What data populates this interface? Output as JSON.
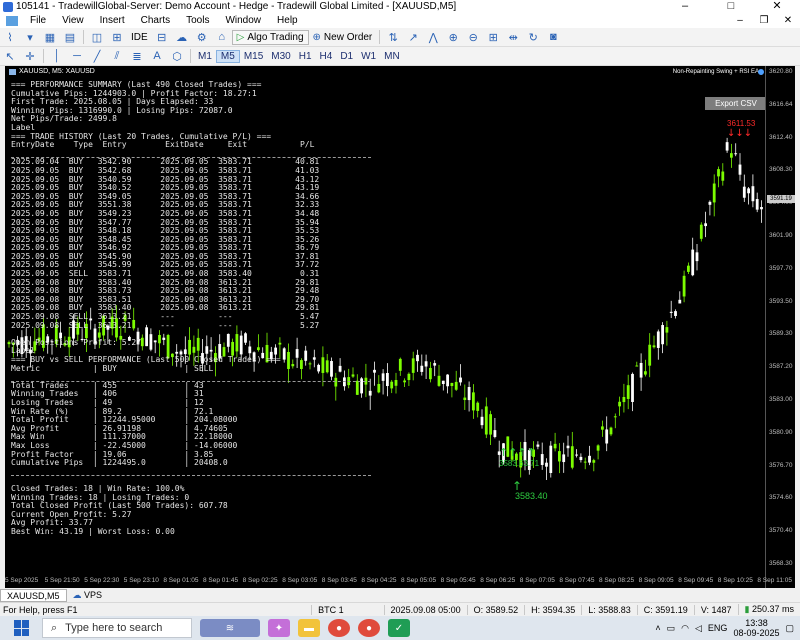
{
  "window": {
    "title": "105141 - TradewillGlobal-Server: Demo Account - Hedge - Tradewill Global Limited - [XAUUSD,M5]",
    "minimize": "–",
    "maximize": "□",
    "close": "✕"
  },
  "menu": [
    "File",
    "View",
    "Insert",
    "Charts",
    "Tools",
    "Window",
    "Help"
  ],
  "menu_right": [
    "–",
    "❐",
    "✕"
  ],
  "toolbar": {
    "ide_label": "IDE",
    "algo_label": "Algo Trading",
    "new_order_label": "New Order"
  },
  "timeframes": [
    {
      "label": "M1",
      "active": false
    },
    {
      "label": "M5",
      "active": true
    },
    {
      "label": "M15",
      "active": false
    },
    {
      "label": "M30",
      "active": false
    },
    {
      "label": "H1",
      "active": false
    },
    {
      "label": "H4",
      "active": false
    },
    {
      "label": "D1",
      "active": false
    },
    {
      "label": "W1",
      "active": false
    },
    {
      "label": "MN",
      "active": false
    }
  ],
  "chart": {
    "symbol_header": "XAUUSD, M5:  XAUUSD",
    "ea_label": "Non-Repainting Swing + RSI EA",
    "export_button": "Export CSV",
    "current_price_tag": "3591.19",
    "red_marker_label": "3611.53",
    "green_marker_label": "3583.40",
    "green_cluster_label": "3583.63.71",
    "colors": {
      "background": "#000000",
      "bull": "#7CFC00",
      "bear": "#FFFFFF",
      "sell_marker": "#FF2A2A",
      "buy_marker": "#2ECC40"
    },
    "price_axis": [
      "3620.80",
      "3616.64",
      "3612.40",
      "3608.30",
      "3604.00",
      "3601.90",
      "3597.70",
      "3593.50",
      "3589.30",
      "3587.20",
      "3583.00",
      "3580.90",
      "3576.70",
      "3574.60",
      "3570.40",
      "3568.30"
    ],
    "time_axis": [
      "5 Sep 2025",
      "5 Sep 21:50",
      "5 Sep 22:30",
      "5 Sep 23:10",
      "8 Sep 01:05",
      "8 Sep 01:45",
      "8 Sep 02:25",
      "8 Sep 03:05",
      "8 Sep 03:45",
      "8 Sep 04:25",
      "8 Sep 05:05",
      "8 Sep 05:45",
      "8 Sep 06:25",
      "8 Sep 07:05",
      "8 Sep 07:45",
      "8 Sep 08:25",
      "8 Sep 09:05",
      "8 Sep 09:45",
      "8 Sep 10:25",
      "8 Sep 11:05"
    ]
  },
  "overlay": [
    "=== PERFORMANCE SUMMARY (Last 490 Closed Trades) ===",
    "Cumulative Pips: 1244903.0 | Profit Factor: 18.27:1",
    "First Trade: 2025.08.05 | Days Elapsed: 33",
    "Winning Pips: 1316990.0 | Losing Pips: 72087.0",
    "Net Pips/Trade: 2499.8",
    "Label",
    "=== TRADE HISTORY (Last 20 Trades, Cumulative P/L) ===",
    "EntryDate    Type  Entry        ExitDate     Exit           P/L",
    "---",
    "2025.09.04  BUY   3542.90      2025.09.05  3583.71         40.81",
    "2025.09.05  BUY   3542.68      2025.09.05  3583.71         41.03",
    "2025.09.05  BUY   3540.59      2025.09.05  3583.71         43.12",
    "2025.09.05  BUY   3540.52      2025.09.05  3583.71         43.19",
    "2025.09.05  BUY   3549.05      2025.09.05  3583.71         34.66",
    "2025.09.05  BUY   3551.38      2025.09.05  3583.71         32.33",
    "2025.09.05  BUY   3549.23      2025.09.05  3583.71         34.48",
    "2025.09.05  BUY   3547.77      2025.09.05  3583.71         35.94",
    "2025.09.05  BUY   3548.18      2025.09.05  3583.71         35.53",
    "2025.09.05  BUY   3548.45      2025.09.05  3583.71         35.26",
    "2025.09.05  BUY   3546.92      2025.09.05  3583.71         36.79",
    "2025.09.05  BUY   3545.90      2025.09.05  3583.71         37.81",
    "2025.09.05  BUY   3545.99      2025.09.05  3583.71         37.72",
    "2025.09.05  SELL  3583.71      2025.09.08  3583.40          0.31",
    "2025.09.08  BUY   3583.40      2025.09.08  3613.21         29.81",
    "2025.09.08  BUY   3583.73      2025.09.08  3613.21         29.48",
    "2025.09.08  BUY   3583.51      2025.09.08  3613.21         29.70",
    "2025.09.08  BUY   3583.40      2025.09.08  3613.21         29.81",
    "2025.09.08  SELL  3613.21      ---         ---              5.47",
    "2025.09.08  SELL  3613.21      ---         ---              5.27",
    "",
    "Open Positions Profit: 5.27",
    "Label",
    "=== BUY vs SELL PERFORMANCE (Last 500 Closed Trades) ===",
    "Metric           | BUY              | SELL",
    "---",
    "Total Trades     | 455              | 43",
    "Winning Trades   | 406              | 31",
    "Losing Trades    | 49               | 12",
    "Win Rate (%)     | 89.2             | 72.1",
    "Total Profit     | 12244.95000      | 204.08000",
    "Avg Profit       | 26.91198         | 4.74605",
    "Max Win          | 111.37000        | 22.18000",
    "Max Loss         | -22.45000        | -14.06000",
    "Profit Factor    | 19.06            | 3.85",
    "Cumulative Pips  | 1224495.0        | 20408.0",
    "---",
    "",
    "Closed Trades: 18 | Win Rate: 100.0%",
    "Winning Trades: 18 | Losing Trades: 0",
    "Total Closed Profit (Last 500 Trades): 607.78",
    "Current Open Profit: 5.27",
    "Avg Profit: 33.77",
    "Best Win: 43.19 | Worst Loss: 0.00"
  ],
  "tabs": [
    {
      "label": "XAUUSD,M5",
      "active": true
    },
    {
      "label": "VPS",
      "active": false
    }
  ],
  "status": {
    "help": "For Help, press F1",
    "profile": "BTC 1",
    "datetime": "2025.09.08 05:00",
    "open": "O: 3589.52",
    "high": "H: 3594.35",
    "low": "L: 3588.83",
    "close": "C: 3591.19",
    "volume": "V: 1487",
    "network": "250.37 ms"
  },
  "taskbar": {
    "search_placeholder": "Type here to search",
    "language": "ENG",
    "time": "13:38",
    "date": "08-09-2025"
  }
}
